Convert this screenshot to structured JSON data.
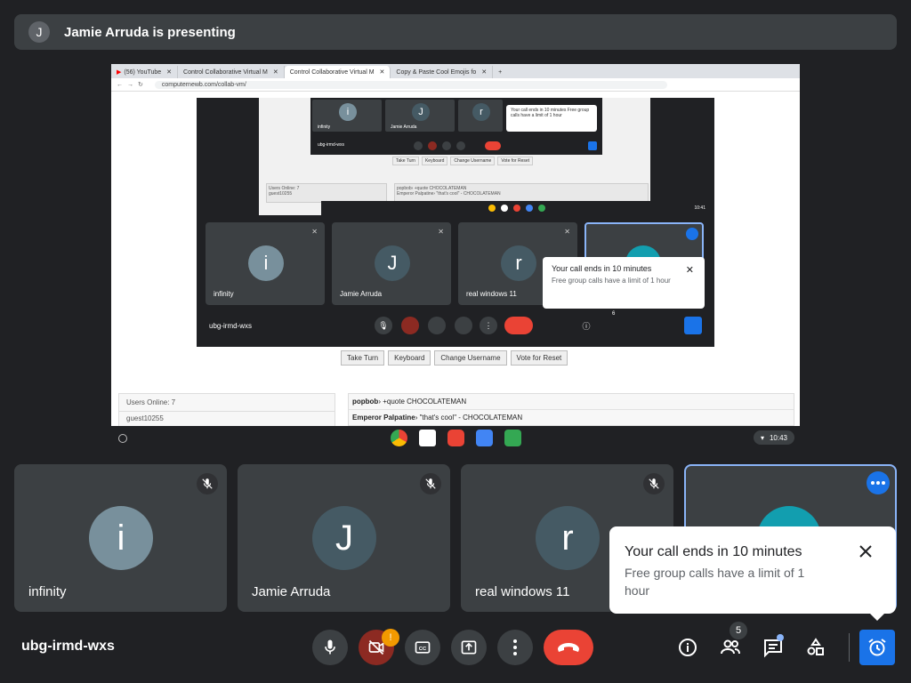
{
  "banner": {
    "avatar_letter": "J",
    "text": "Jamie Arruda is presenting"
  },
  "browser": {
    "tabs": [
      {
        "label": "(56) YouTube",
        "close": "✕"
      },
      {
        "label": "Control Collaborative Virtual M",
        "close": "✕"
      },
      {
        "label": "Control Collaborative Virtual M",
        "close": "✕"
      },
      {
        "label": "Copy & Paste Cool Emojis fo",
        "close": "✕"
      }
    ],
    "new_tab": "+",
    "url": "computernewb.com/collab-vm/"
  },
  "shared_meet": {
    "participants": [
      {
        "letter": "i",
        "name": "infinity",
        "color": "#78909c"
      },
      {
        "letter": "J",
        "name": "Jamie Arruda",
        "color": "#455a64"
      },
      {
        "letter": "r",
        "name": "real windows 11",
        "color": "#455a64"
      }
    ],
    "popup_title": "Your call ends in 10 minutes",
    "popup_sub": "Free group calls have a limit of 1 hour",
    "popup_close": "✕",
    "meeting_code": "ubg-irmd-wxs",
    "people_count": "6",
    "mini_code": "ubg-irmd-wxs",
    "mini_popup": "Your call ends in 10 minutes Free group calls have a limit of 1 hour"
  },
  "vm": {
    "buttons": [
      "Take Turn",
      "Keyboard",
      "Change Username",
      "Vote for Reset"
    ],
    "users_header": "Users Online: 7",
    "users_first": "guest10255",
    "chat": [
      {
        "user": "popbob",
        "msg": "+quote CHOCOLATEMAN"
      },
      {
        "user": "Emperor Palpatine",
        "msg": "\"that's cool\" - CHOCOLATEMAN"
      }
    ],
    "inner_users_header": "Users Online: 7",
    "inner_users_first": "guest10255",
    "inner_chat_1": "popbob› +quote CHOCOLATEMAN",
    "inner_chat_2": "Emperor Palpatine› \"that's cool\" - CHOCOLATEMAN"
  },
  "taskbar": {
    "time": "10:43",
    "inner_time": "10:41"
  },
  "participants": [
    {
      "letter": "i",
      "name": "infinity",
      "color": "#78909c"
    },
    {
      "letter": "J",
      "name": "Jamie Arruda",
      "color": "#455a64"
    },
    {
      "letter": "r",
      "name": "real windows 11",
      "color": "#455a64"
    }
  ],
  "popup": {
    "title": "Your call ends in 10 minutes",
    "subtitle": "Free group calls have a limit of 1 hour"
  },
  "controls": {
    "meeting_code": "ubg-irmd-wxs",
    "camera_alert": "!",
    "people_count": "5"
  },
  "colors": {
    "end_call": "#ea4335",
    "accent": "#1a73e8",
    "alert": "#f29900",
    "teal": "#129eaf"
  }
}
